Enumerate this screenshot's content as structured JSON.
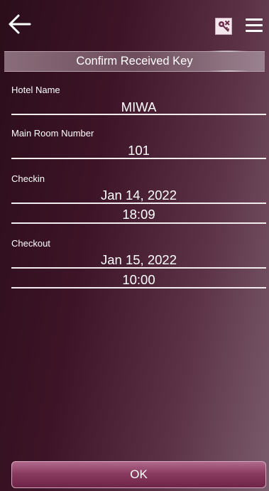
{
  "header": {
    "back_icon": "arrow-left-icon",
    "key_icon": "key-cancel-icon",
    "menu_icon": "hamburger-menu-icon",
    "title": "Confirm Received Key"
  },
  "form": {
    "hotel_name": {
      "label": "Hotel Name",
      "value": "MIWA"
    },
    "main_room_number": {
      "label": "Main Room Number",
      "value": "101"
    },
    "checkin": {
      "label": "Checkin",
      "date": "Jan 14, 2022",
      "time": "18:09"
    },
    "checkout": {
      "label": "Checkout",
      "date": "Jan 15, 2022",
      "time": "10:00"
    }
  },
  "footer": {
    "ok_label": "OK"
  },
  "colors": {
    "background_dark": "#2b0d1a",
    "background_light": "#7a5c6c",
    "button": "#8a3b60",
    "text": "#ffffff"
  }
}
